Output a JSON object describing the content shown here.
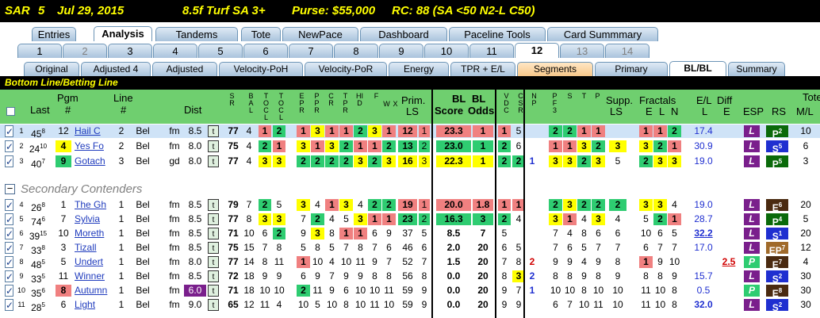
{
  "title": {
    "track": "SAR",
    "race": "5",
    "date": "Jul 29, 2015",
    "conditions": "8.5f  Turf  SA  3+",
    "purse": "Purse: $55,000",
    "rc": "RC: 88  (SA <50 N2-L C50)"
  },
  "tabs_main": [
    "Entries",
    "Analysis",
    "Tandems",
    "Tote",
    "NewPace",
    "Dashboard",
    "Paceline Tools",
    "Card Summmary"
  ],
  "tabs_main_active": "Analysis",
  "tabs_race": [
    "1",
    "2",
    "3",
    "4",
    "5",
    "6",
    "7",
    "8",
    "9",
    "10",
    "11",
    "12",
    "13",
    "14"
  ],
  "tabs_race_active": "12",
  "tabs_view": [
    "Original",
    "Adjusted 4",
    "Adjusted",
    "Velocity-PoH",
    "Velocity-PoR",
    "Energy",
    "TPR + E/L",
    "Segments",
    "Primary",
    "BL/BL",
    "Summary"
  ],
  "tabs_view_active": "BL/BL",
  "band_label": "Bottom Line/Betting Line",
  "secondary_label": "Secondary Contenders",
  "headers": {
    "last": "Last",
    "pgm": "Pgm",
    "pgm_sub": "#",
    "line": "Line",
    "line_sub": "#",
    "dist": "Dist",
    "col_sr": "SR",
    "col_bal": "BAL",
    "col_tocl": "TOCL",
    "col_epr": "EPR",
    "col_ppr": "PPR",
    "col_cr": "CR",
    "col_tpr": "TPR",
    "col_hid": "HID",
    "col_f": "F",
    "col_w": "W",
    "col_x": "X",
    "prim": "Prim.",
    "prim_sub": "LS",
    "bl1": "BL",
    "bl2": "BL",
    "score": "Score",
    "odds": "Odds",
    "col_vdc": "VDC",
    "col_csr": "CSR",
    "col_np": "NP",
    "col_pf3": "PF3",
    "col_ss": "S",
    "col_tt": "T",
    "col_pp": "P",
    "supp1": "Supp.",
    "supp2": "LS",
    "fractals": "Fractals",
    "fe": "E",
    "fl": "L",
    "fn": "N",
    "el": "E/L",
    "diff": "Diff",
    "l": "L",
    "e": "E",
    "esp": "ESP",
    "rs": "RS",
    "tote": "Tote",
    "ml": "M/L"
  },
  "rows": [
    {
      "n": "1",
      "last": "45",
      "lastsup": "8",
      "pgm": "12",
      "line": "2",
      "trk": "Bel",
      "surf": "fm",
      "dist": "8.5",
      "t": "t",
      "sr": "77",
      "bal": "4",
      "tocl1": "1",
      "tocl2": "2",
      "e": [
        "1",
        "3",
        "1",
        "1",
        "2",
        "3",
        "1"
      ],
      "prim": "12",
      "primsub": "1",
      "score": "23.3",
      "odds": "1",
      "vdc": "1",
      "csr": "5",
      "np": "",
      "p": [
        "2",
        "2",
        "1",
        "1"
      ],
      "supp": "",
      "fr": [
        "1",
        "1",
        "2"
      ],
      "el": "17.4",
      "diff": "",
      "esp": "L",
      "rs": "P",
      "rssup": "2",
      "ml": "10"
    },
    {
      "n": "2",
      "last": "24",
      "lastsup": "10",
      "pgm": "4",
      "line": "2",
      "trk": "Bel",
      "surf": "fm",
      "dist": "8.0",
      "t": "t",
      "sr": "75",
      "bal": "4",
      "tocl1": "2",
      "tocl2": "1",
      "e": [
        "3",
        "1",
        "3",
        "2",
        "1",
        "1",
        "2"
      ],
      "prim": "13",
      "primsub": "2",
      "score": "23.0",
      "odds": "1",
      "vdc": "2",
      "csr": "6",
      "np": "",
      "p": [
        "1",
        "1",
        "3",
        "2"
      ],
      "supp": "3",
      "fr": [
        "3",
        "2",
        "1"
      ],
      "el": "30.9",
      "diff": "",
      "esp": "L",
      "rs": "S",
      "rssup": "5",
      "ml": "6"
    },
    {
      "n": "3",
      "last": "40",
      "lastsup": "7",
      "pgm": "9",
      "line": "3",
      "trk": "Bel",
      "surf": "gd",
      "dist": "8.0",
      "t": "t",
      "sr": "77",
      "bal": "4",
      "tocl1": "3",
      "tocl2": "3",
      "e": [
        "2",
        "2",
        "2",
        "2",
        "3",
        "2",
        "3"
      ],
      "prim": "16",
      "primsub": "3",
      "score": "22.3",
      "odds": "1",
      "vdc": "2",
      "csr": "2",
      "np": "1",
      "p": [
        "3",
        "3",
        "2",
        "3"
      ],
      "supp": "5",
      "fr": [
        "2",
        "3",
        "3"
      ],
      "el": "19.0",
      "diff": "",
      "esp": "L",
      "rs": "P",
      "rssup": "5",
      "ml": "3"
    },
    {
      "n": "4",
      "last": "26",
      "lastsup": "8",
      "pgm": "1",
      "line": "1",
      "trk": "Bel",
      "surf": "fm",
      "dist": "8.5",
      "t": "t",
      "sr": "79",
      "bal": "7",
      "tocl1": "2",
      "tocl2": "5",
      "e": [
        "3",
        "4",
        "1",
        "3",
        "4",
        "2",
        "2"
      ],
      "prim": "19",
      "primsub": "1",
      "score": "20.0",
      "odds": "1.8",
      "vdc": "1",
      "csr": "1",
      "np": "",
      "p": [
        "2",
        "3",
        "2",
        "2"
      ],
      "supp": "2",
      "fr": [
        "3",
        "3",
        "4"
      ],
      "el": "19.0",
      "diff": "",
      "esp": "L",
      "rs": "E",
      "rssup": "6",
      "ml": "20"
    },
    {
      "n": "5",
      "last": "74",
      "lastsup": "6",
      "pgm": "7",
      "line": "1",
      "trk": "Bel",
      "surf": "fm",
      "dist": "8.5",
      "t": "t",
      "sr": "77",
      "bal": "8",
      "tocl1": "3",
      "tocl2": "3",
      "e": [
        "7",
        "2",
        "4",
        "5",
        "3",
        "1",
        "1"
      ],
      "prim": "23",
      "primsub": "2",
      "score": "16.3",
      "odds": "3",
      "vdc": "2",
      "csr": "4",
      "np": "",
      "p": [
        "3",
        "1",
        "4",
        "3"
      ],
      "supp": "4",
      "fr": [
        "5",
        "2",
        "1"
      ],
      "el": "28.7",
      "diff": "",
      "esp": "L",
      "rs": "P",
      "rssup": "4",
      "ml": "5"
    },
    {
      "n": "6",
      "last": "39",
      "lastsup": "15",
      "pgm": "10",
      "line": "1",
      "trk": "Bel",
      "surf": "fm",
      "dist": "8.5",
      "t": "t",
      "sr": "71",
      "bal": "10",
      "tocl1": "6",
      "tocl2": "2",
      "e": [
        "9",
        "3",
        "8",
        "1",
        "1",
        "6",
        "9"
      ],
      "prim": "37",
      "primsub": "5",
      "score": "8.5",
      "odds": "7",
      "vdc": "5",
      "csr": "",
      "np": "",
      "p": [
        "7",
        "4",
        "8",
        "6"
      ],
      "supp": "6",
      "fr": [
        "10",
        "6",
        "5"
      ],
      "el": "32.2",
      "diff": "",
      "esp": "L",
      "rs": "S",
      "rssup": "1",
      "ml": "20"
    },
    {
      "n": "7",
      "last": "33",
      "lastsup": "8",
      "pgm": "3",
      "line": "1",
      "trk": "Bel",
      "surf": "fm",
      "dist": "8.5",
      "t": "t",
      "sr": "75",
      "bal": "15",
      "tocl1": "7",
      "tocl2": "8",
      "e": [
        "5",
        "8",
        "5",
        "7",
        "8",
        "7",
        "6"
      ],
      "prim": "46",
      "primsub": "6",
      "score": "2.0",
      "odds": "20",
      "vdc": "6",
      "csr": "5",
      "np": "",
      "p": [
        "7",
        "6",
        "5",
        "7"
      ],
      "supp": "7",
      "fr": [
        "6",
        "7",
        "7"
      ],
      "el": "17.0",
      "diff": "",
      "esp": "L",
      "rs": "EP",
      "rssup": "7",
      "ml": "12"
    },
    {
      "n": "8",
      "last": "48",
      "lastsup": "5",
      "pgm": "5",
      "line": "1",
      "trk": "Bel",
      "surf": "fm",
      "dist": "8.0",
      "t": "t",
      "sr": "77",
      "bal": "14",
      "tocl1": "8",
      "tocl2": "11",
      "e": [
        "1",
        "10",
        "4",
        "10",
        "11",
        "9",
        "7"
      ],
      "prim": "52",
      "primsub": "7",
      "score": "1.5",
      "odds": "20",
      "vdc": "7",
      "csr": "8",
      "np": "2",
      "p": [
        "9",
        "9",
        "4",
        "9"
      ],
      "supp": "8",
      "fr": [
        "1",
        "9",
        "10"
      ],
      "el": "",
      "diff": "2.5",
      "esp": "P",
      "rs": "E",
      "rssup": "7",
      "ml": "4"
    },
    {
      "n": "9",
      "last": "33",
      "lastsup": "5",
      "pgm": "11",
      "line": "1",
      "trk": "Bel",
      "surf": "fm",
      "dist": "8.5",
      "t": "t",
      "sr": "72",
      "bal": "18",
      "tocl1": "9",
      "tocl2": "9",
      "e": [
        "6",
        "9",
        "7",
        "9",
        "9",
        "8",
        "8"
      ],
      "prim": "56",
      "primsub": "8",
      "score": "0.0",
      "odds": "20",
      "vdc": "8",
      "csr": "3",
      "np": "2",
      "p": [
        "8",
        "8",
        "9",
        "8"
      ],
      "supp": "9",
      "fr": [
        "8",
        "8",
        "9"
      ],
      "el": "15.7",
      "diff": "",
      "esp": "L",
      "rs": "S",
      "rssup": "2",
      "ml": "30"
    },
    {
      "n": "10",
      "last": "35",
      "lastsup": "6",
      "pgm": "8",
      "line": "1",
      "trk": "Bel",
      "surf": "fm",
      "dist": "6.0",
      "t": "t",
      "sr": "71",
      "bal": "18",
      "tocl1": "10",
      "tocl2": "10",
      "e": [
        "2",
        "11",
        "9",
        "6",
        "10",
        "10",
        "11"
      ],
      "prim": "59",
      "primsub": "9",
      "score": "0.0",
      "odds": "20",
      "vdc": "9",
      "csr": "7",
      "np": "1",
      "p": [
        "10",
        "10",
        "8",
        "10"
      ],
      "supp": "10",
      "fr": [
        "11",
        "10",
        "8"
      ],
      "el": "0.5",
      "diff": "",
      "esp": "P",
      "rs": "E",
      "rssup": "8",
      "ml": "30"
    },
    {
      "n": "11",
      "last": "28",
      "lastsup": "5",
      "pgm": "6",
      "line": "1",
      "trk": "Bel",
      "surf": "fm",
      "dist": "9.0",
      "t": "t",
      "sr": "65",
      "bal": "12",
      "tocl1": "11",
      "tocl2": "4",
      "e": [
        "10",
        "5",
        "10",
        "8",
        "10",
        "11",
        "10"
      ],
      "prim": "59",
      "primsub": "9",
      "score": "0.0",
      "odds": "20",
      "vdc": "9",
      "csr": "9",
      "np": "",
      "p": [
        "6",
        "7",
        "10",
        "11"
      ],
      "supp": "10",
      "fr": [
        "11",
        "10",
        "8"
      ],
      "el": "32.0",
      "diff": "",
      "esp": "L",
      "rs": "S",
      "rssup": "2",
      "ml": "30"
    }
  ],
  "colors": {
    "red": "#f08080",
    "yellow": "#ffff00",
    "green": "#2ecc71",
    "purple": "#7a1f8c",
    "rs_blue": "#1f2fd0",
    "rs_dark": "#4a2a10",
    "rs_green": "#0a6a0a",
    "header_green": "#6fcf6f"
  }
}
